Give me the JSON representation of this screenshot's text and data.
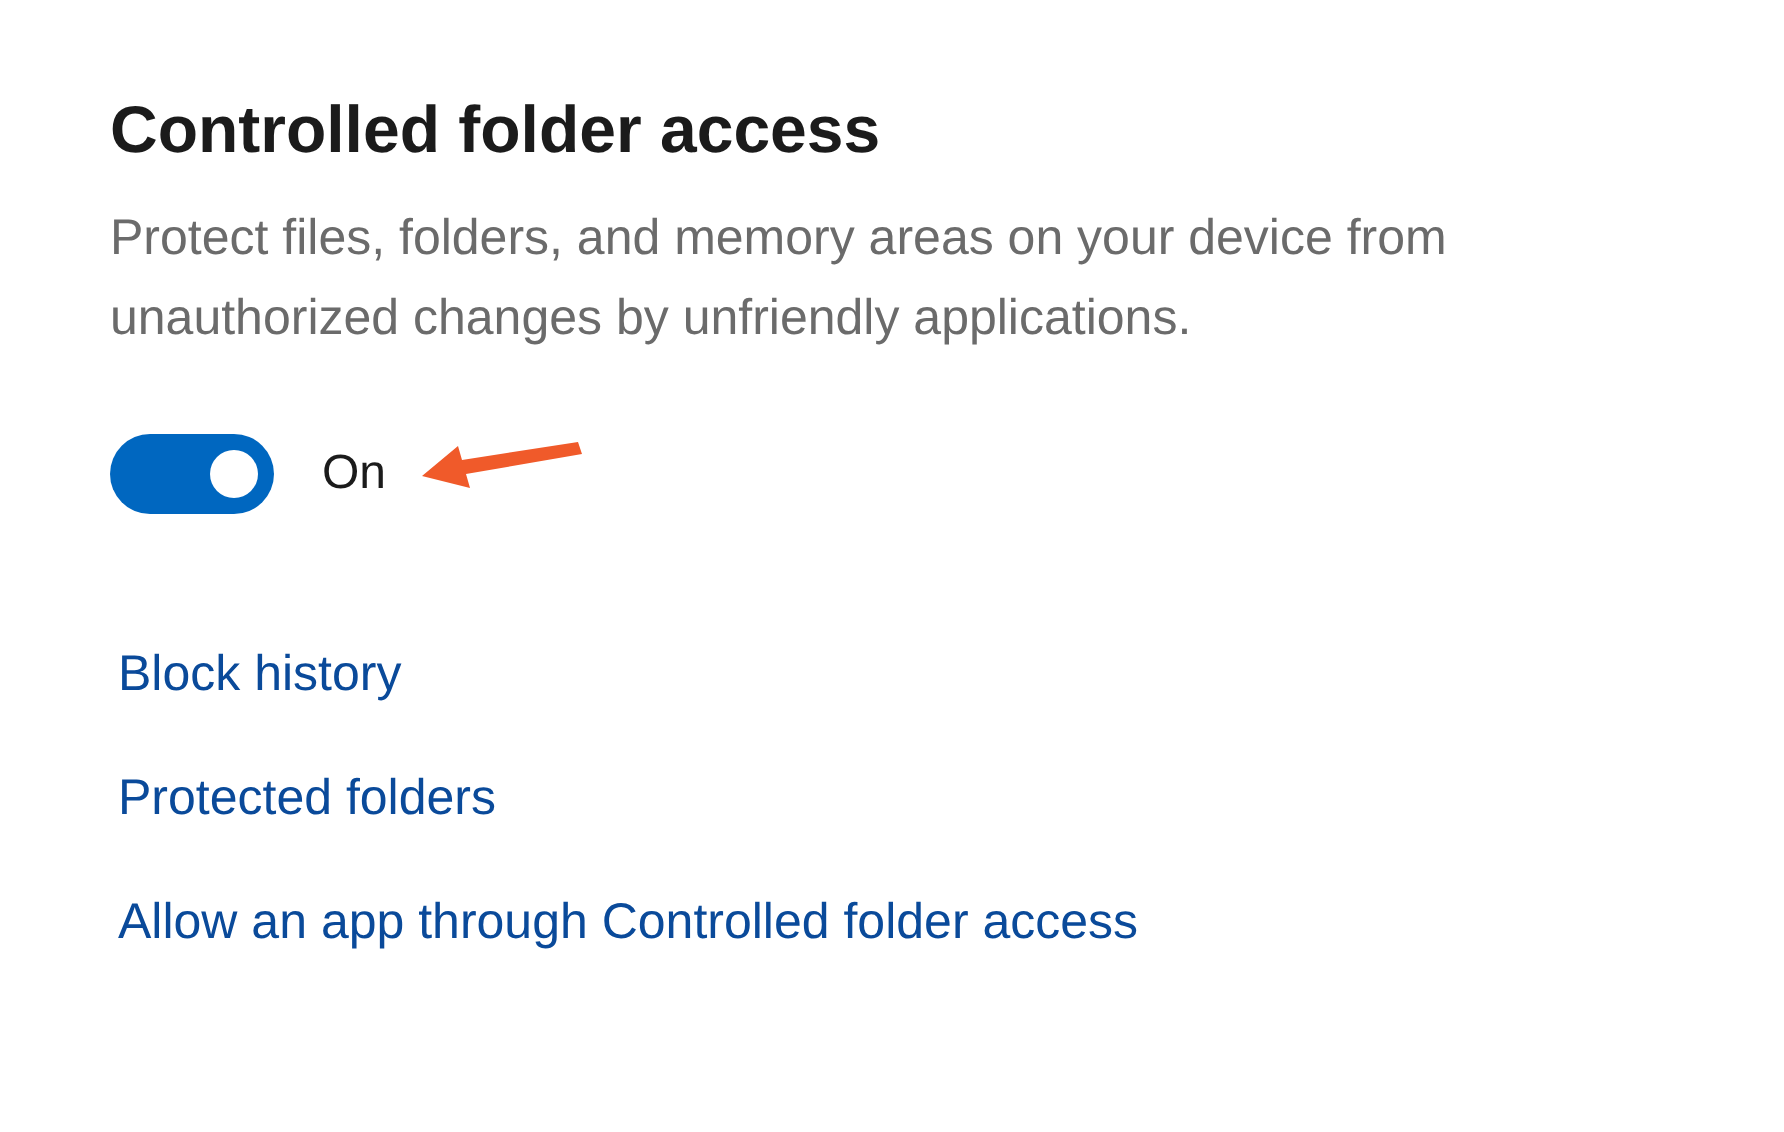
{
  "title": "Controlled folder access",
  "description": "Protect files, folders, and memory areas on your device from unauthorized changes by unfriendly applications.",
  "toggle": {
    "on": true,
    "label": "On"
  },
  "links": [
    "Block history",
    "Protected folders",
    "Allow an app through Controlled folder access"
  ]
}
